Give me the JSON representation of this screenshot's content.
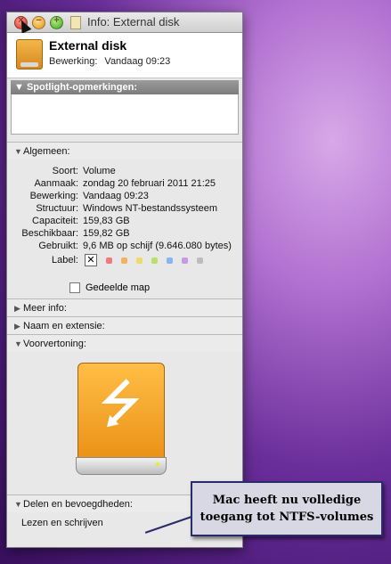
{
  "window": {
    "title": "Info: External disk"
  },
  "header": {
    "name": "External disk",
    "modified_label": "Bewerking:",
    "modified_value": "Vandaag 09:23"
  },
  "spotlight": {
    "label": "Spotlight-opmerkingen:"
  },
  "general": {
    "label": "Algemeen:",
    "rows": [
      {
        "key": "Soort:",
        "value": "Volume"
      },
      {
        "key": "Aanmaak:",
        "value": "zondag 20 februari 2011 21:25"
      },
      {
        "key": "Bewerking:",
        "value": "Vandaag 09:23"
      },
      {
        "key": "Structuur:",
        "value": "Windows NT-bestandssysteem"
      },
      {
        "key": "Capaciteit:",
        "value": "159,83 GB"
      },
      {
        "key": "Beschikbaar:",
        "value": "159,82 GB"
      },
      {
        "key": "Gebruikt:",
        "value": "9,6 MB op schijf (9.646.080 bytes)"
      }
    ],
    "label_key": "Label:",
    "label_colors": [
      "#f07a7a",
      "#f5b060",
      "#efdb6a",
      "#b9e06a",
      "#8ab4f0",
      "#c79ae8",
      "#bdbdbd"
    ],
    "shared_folder": "Gedeelde map"
  },
  "sections": {
    "more_info": "Meer info:",
    "name_ext": "Naam en extensie:",
    "preview": "Voorvertoning:",
    "sharing": "Delen en bevoegdheden:",
    "permission": "Lezen en schrijven"
  },
  "callout": {
    "line1": "Mac heeft nu volledige",
    "line2": "toegang tot NTFS-volumes"
  }
}
